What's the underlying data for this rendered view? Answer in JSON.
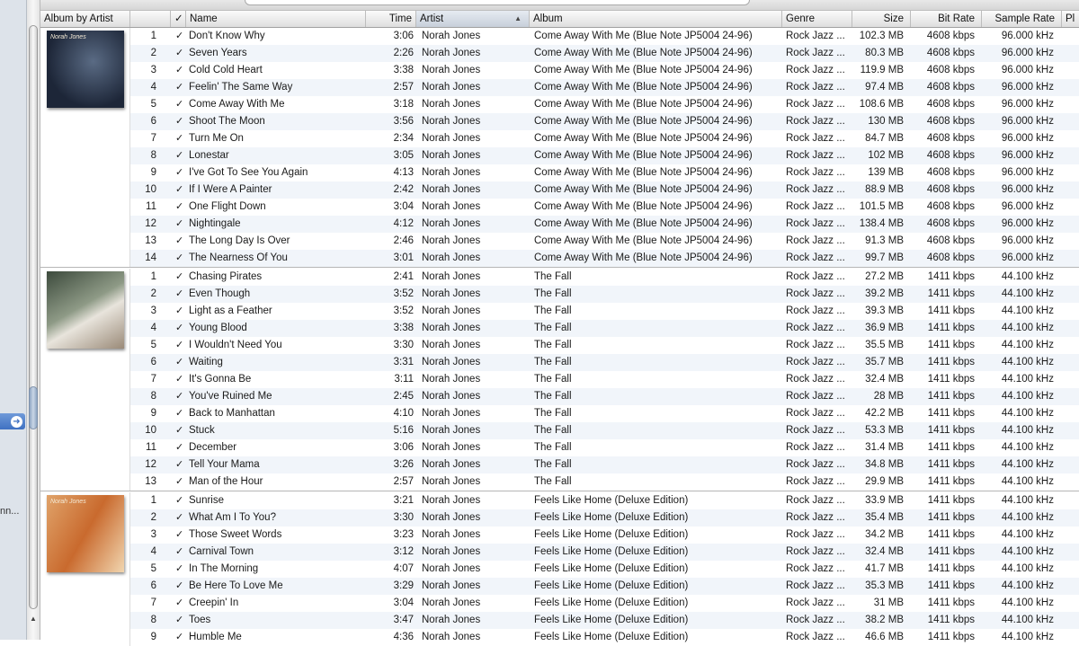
{
  "sidebar": {
    "truncated_label": "nn..."
  },
  "columns": {
    "album_by_artist": "Album by Artist",
    "checked": "✓",
    "name": "Name",
    "time": "Time",
    "artist": "Artist",
    "album": "Album",
    "genre": "Genre",
    "size": "Size",
    "bit_rate": "Bit Rate",
    "sample_rate": "Sample Rate",
    "plays": "Pl"
  },
  "albums": [
    {
      "art_label": "Norah Jones",
      "tracks": [
        {
          "n": "1",
          "name": "Don't Know Why",
          "time": "3:06",
          "artist": "Norah Jones",
          "album": "Come Away With Me (Blue Note JP5004 24-96)",
          "genre": "Rock Jazz ...",
          "size": "102.3 MB",
          "bitrate": "4608 kbps",
          "samplerate": "96.000 kHz"
        },
        {
          "n": "2",
          "name": "Seven Years",
          "time": "2:26",
          "artist": "Norah Jones",
          "album": "Come Away With Me (Blue Note JP5004 24-96)",
          "genre": "Rock Jazz ...",
          "size": "80.3 MB",
          "bitrate": "4608 kbps",
          "samplerate": "96.000 kHz"
        },
        {
          "n": "3",
          "name": "Cold Cold Heart",
          "time": "3:38",
          "artist": "Norah Jones",
          "album": "Come Away With Me (Blue Note JP5004 24-96)",
          "genre": "Rock Jazz ...",
          "size": "119.9 MB",
          "bitrate": "4608 kbps",
          "samplerate": "96.000 kHz"
        },
        {
          "n": "4",
          "name": "Feelin' The Same Way",
          "time": "2:57",
          "artist": "Norah Jones",
          "album": "Come Away With Me (Blue Note JP5004 24-96)",
          "genre": "Rock Jazz ...",
          "size": "97.4 MB",
          "bitrate": "4608 kbps",
          "samplerate": "96.000 kHz"
        },
        {
          "n": "5",
          "name": "Come Away With Me",
          "time": "3:18",
          "artist": "Norah Jones",
          "album": "Come Away With Me (Blue Note JP5004 24-96)",
          "genre": "Rock Jazz ...",
          "size": "108.6 MB",
          "bitrate": "4608 kbps",
          "samplerate": "96.000 kHz"
        },
        {
          "n": "6",
          "name": "Shoot The Moon",
          "time": "3:56",
          "artist": "Norah Jones",
          "album": "Come Away With Me (Blue Note JP5004 24-96)",
          "genre": "Rock Jazz ...",
          "size": "130 MB",
          "bitrate": "4608 kbps",
          "samplerate": "96.000 kHz"
        },
        {
          "n": "7",
          "name": "Turn Me On",
          "time": "2:34",
          "artist": "Norah Jones",
          "album": "Come Away With Me (Blue Note JP5004 24-96)",
          "genre": "Rock Jazz ...",
          "size": "84.7 MB",
          "bitrate": "4608 kbps",
          "samplerate": "96.000 kHz"
        },
        {
          "n": "8",
          "name": "Lonestar",
          "time": "3:05",
          "artist": "Norah Jones",
          "album": "Come Away With Me (Blue Note JP5004 24-96)",
          "genre": "Rock Jazz ...",
          "size": "102 MB",
          "bitrate": "4608 kbps",
          "samplerate": "96.000 kHz"
        },
        {
          "n": "9",
          "name": "I've Got To See You Again",
          "time": "4:13",
          "artist": "Norah Jones",
          "album": "Come Away With Me (Blue Note JP5004 24-96)",
          "genre": "Rock Jazz ...",
          "size": "139 MB",
          "bitrate": "4608 kbps",
          "samplerate": "96.000 kHz"
        },
        {
          "n": "10",
          "name": "If I Were A Painter",
          "time": "2:42",
          "artist": "Norah Jones",
          "album": "Come Away With Me (Blue Note JP5004 24-96)",
          "genre": "Rock Jazz ...",
          "size": "88.9 MB",
          "bitrate": "4608 kbps",
          "samplerate": "96.000 kHz"
        },
        {
          "n": "11",
          "name": "One Flight Down",
          "time": "3:04",
          "artist": "Norah Jones",
          "album": "Come Away With Me (Blue Note JP5004 24-96)",
          "genre": "Rock Jazz ...",
          "size": "101.5 MB",
          "bitrate": "4608 kbps",
          "samplerate": "96.000 kHz"
        },
        {
          "n": "12",
          "name": "Nightingale",
          "time": "4:12",
          "artist": "Norah Jones",
          "album": "Come Away With Me (Blue Note JP5004 24-96)",
          "genre": "Rock Jazz ...",
          "size": "138.4 MB",
          "bitrate": "4608 kbps",
          "samplerate": "96.000 kHz"
        },
        {
          "n": "13",
          "name": "The Long Day Is Over",
          "time": "2:46",
          "artist": "Norah Jones",
          "album": "Come Away With Me (Blue Note JP5004 24-96)",
          "genre": "Rock Jazz ...",
          "size": "91.3 MB",
          "bitrate": "4608 kbps",
          "samplerate": "96.000 kHz"
        },
        {
          "n": "14",
          "name": "The Nearness Of You",
          "time": "3:01",
          "artist": "Norah Jones",
          "album": "Come Away With Me (Blue Note JP5004 24-96)",
          "genre": "Rock Jazz ...",
          "size": "99.7 MB",
          "bitrate": "4608 kbps",
          "samplerate": "96.000 kHz"
        }
      ]
    },
    {
      "art_label": "",
      "tracks": [
        {
          "n": "1",
          "name": "Chasing Pirates",
          "time": "2:41",
          "artist": "Norah Jones",
          "album": "The Fall",
          "genre": "Rock Jazz ...",
          "size": "27.2 MB",
          "bitrate": "1411 kbps",
          "samplerate": "44.100 kHz"
        },
        {
          "n": "2",
          "name": "Even Though",
          "time": "3:52",
          "artist": "Norah Jones",
          "album": "The Fall",
          "genre": "Rock Jazz ...",
          "size": "39.2 MB",
          "bitrate": "1411 kbps",
          "samplerate": "44.100 kHz"
        },
        {
          "n": "3",
          "name": "Light as a Feather",
          "time": "3:52",
          "artist": "Norah Jones",
          "album": "The Fall",
          "genre": "Rock Jazz ...",
          "size": "39.3 MB",
          "bitrate": "1411 kbps",
          "samplerate": "44.100 kHz"
        },
        {
          "n": "4",
          "name": "Young Blood",
          "time": "3:38",
          "artist": "Norah Jones",
          "album": "The Fall",
          "genre": "Rock Jazz ...",
          "size": "36.9 MB",
          "bitrate": "1411 kbps",
          "samplerate": "44.100 kHz"
        },
        {
          "n": "5",
          "name": "I Wouldn't Need You",
          "time": "3:30",
          "artist": "Norah Jones",
          "album": "The Fall",
          "genre": "Rock Jazz ...",
          "size": "35.5 MB",
          "bitrate": "1411 kbps",
          "samplerate": "44.100 kHz"
        },
        {
          "n": "6",
          "name": "Waiting",
          "time": "3:31",
          "artist": "Norah Jones",
          "album": "The Fall",
          "genre": "Rock Jazz ...",
          "size": "35.7 MB",
          "bitrate": "1411 kbps",
          "samplerate": "44.100 kHz"
        },
        {
          "n": "7",
          "name": "It's Gonna Be",
          "time": "3:11",
          "artist": "Norah Jones",
          "album": "The Fall",
          "genre": "Rock Jazz ...",
          "size": "32.4 MB",
          "bitrate": "1411 kbps",
          "samplerate": "44.100 kHz"
        },
        {
          "n": "8",
          "name": "You've Ruined Me",
          "time": "2:45",
          "artist": "Norah Jones",
          "album": "The Fall",
          "genre": "Rock Jazz ...",
          "size": "28 MB",
          "bitrate": "1411 kbps",
          "samplerate": "44.100 kHz"
        },
        {
          "n": "9",
          "name": "Back to Manhattan",
          "time": "4:10",
          "artist": "Norah Jones",
          "album": "The Fall",
          "genre": "Rock Jazz ...",
          "size": "42.2 MB",
          "bitrate": "1411 kbps",
          "samplerate": "44.100 kHz"
        },
        {
          "n": "10",
          "name": "Stuck",
          "time": "5:16",
          "artist": "Norah Jones",
          "album": "The Fall",
          "genre": "Rock Jazz ...",
          "size": "53.3 MB",
          "bitrate": "1411 kbps",
          "samplerate": "44.100 kHz"
        },
        {
          "n": "11",
          "name": "December",
          "time": "3:06",
          "artist": "Norah Jones",
          "album": "The Fall",
          "genre": "Rock Jazz ...",
          "size": "31.4 MB",
          "bitrate": "1411 kbps",
          "samplerate": "44.100 kHz"
        },
        {
          "n": "12",
          "name": "Tell Your Mama",
          "time": "3:26",
          "artist": "Norah Jones",
          "album": "The Fall",
          "genre": "Rock Jazz ...",
          "size": "34.8 MB",
          "bitrate": "1411 kbps",
          "samplerate": "44.100 kHz"
        },
        {
          "n": "13",
          "name": "Man of the Hour",
          "time": "2:57",
          "artist": "Norah Jones",
          "album": "The Fall",
          "genre": "Rock Jazz ...",
          "size": "29.9 MB",
          "bitrate": "1411 kbps",
          "samplerate": "44.100 kHz"
        }
      ]
    },
    {
      "art_label": "Norah Jones",
      "tracks": [
        {
          "n": "1",
          "name": "Sunrise",
          "time": "3:21",
          "artist": "Norah Jones",
          "album": "Feels Like Home (Deluxe Edition)",
          "genre": "Rock Jazz ...",
          "size": "33.9 MB",
          "bitrate": "1411 kbps",
          "samplerate": "44.100 kHz"
        },
        {
          "n": "2",
          "name": "What Am I To You?",
          "time": "3:30",
          "artist": "Norah Jones",
          "album": "Feels Like Home (Deluxe Edition)",
          "genre": "Rock Jazz ...",
          "size": "35.4 MB",
          "bitrate": "1411 kbps",
          "samplerate": "44.100 kHz"
        },
        {
          "n": "3",
          "name": "Those Sweet Words",
          "time": "3:23",
          "artist": "Norah Jones",
          "album": "Feels Like Home (Deluxe Edition)",
          "genre": "Rock Jazz ...",
          "size": "34.2 MB",
          "bitrate": "1411 kbps",
          "samplerate": "44.100 kHz"
        },
        {
          "n": "4",
          "name": "Carnival Town",
          "time": "3:12",
          "artist": "Norah Jones",
          "album": "Feels Like Home (Deluxe Edition)",
          "genre": "Rock Jazz ...",
          "size": "32.4 MB",
          "bitrate": "1411 kbps",
          "samplerate": "44.100 kHz"
        },
        {
          "n": "5",
          "name": "In The Morning",
          "time": "4:07",
          "artist": "Norah Jones",
          "album": "Feels Like Home (Deluxe Edition)",
          "genre": "Rock Jazz ...",
          "size": "41.7 MB",
          "bitrate": "1411 kbps",
          "samplerate": "44.100 kHz"
        },
        {
          "n": "6",
          "name": "Be Here To Love Me",
          "time": "3:29",
          "artist": "Norah Jones",
          "album": "Feels Like Home (Deluxe Edition)",
          "genre": "Rock Jazz ...",
          "size": "35.3 MB",
          "bitrate": "1411 kbps",
          "samplerate": "44.100 kHz"
        },
        {
          "n": "7",
          "name": "Creepin' In",
          "time": "3:04",
          "artist": "Norah Jones",
          "album": "Feels Like Home (Deluxe Edition)",
          "genre": "Rock Jazz ...",
          "size": "31 MB",
          "bitrate": "1411 kbps",
          "samplerate": "44.100 kHz"
        },
        {
          "n": "8",
          "name": "Toes",
          "time": "3:47",
          "artist": "Norah Jones",
          "album": "Feels Like Home (Deluxe Edition)",
          "genre": "Rock Jazz ...",
          "size": "38.2 MB",
          "bitrate": "1411 kbps",
          "samplerate": "44.100 kHz"
        },
        {
          "n": "9",
          "name": "Humble Me",
          "time": "4:36",
          "artist": "Norah Jones",
          "album": "Feels Like Home (Deluxe Edition)",
          "genre": "Rock Jazz ...",
          "size": "46.6 MB",
          "bitrate": "1411 kbps",
          "samplerate": "44.100 kHz"
        }
      ]
    }
  ],
  "colors": {
    "row_stripe": "#f1f5fa",
    "row_plain": "#ffffff",
    "header_sorted": "#cdd6e3",
    "selection_accent": "#3f71c2"
  },
  "icons": {
    "checkbox": "checkmark-icon",
    "sort": "sort-ascending-icon",
    "sidebar_arrow": "arrow-right-circle-icon"
  }
}
